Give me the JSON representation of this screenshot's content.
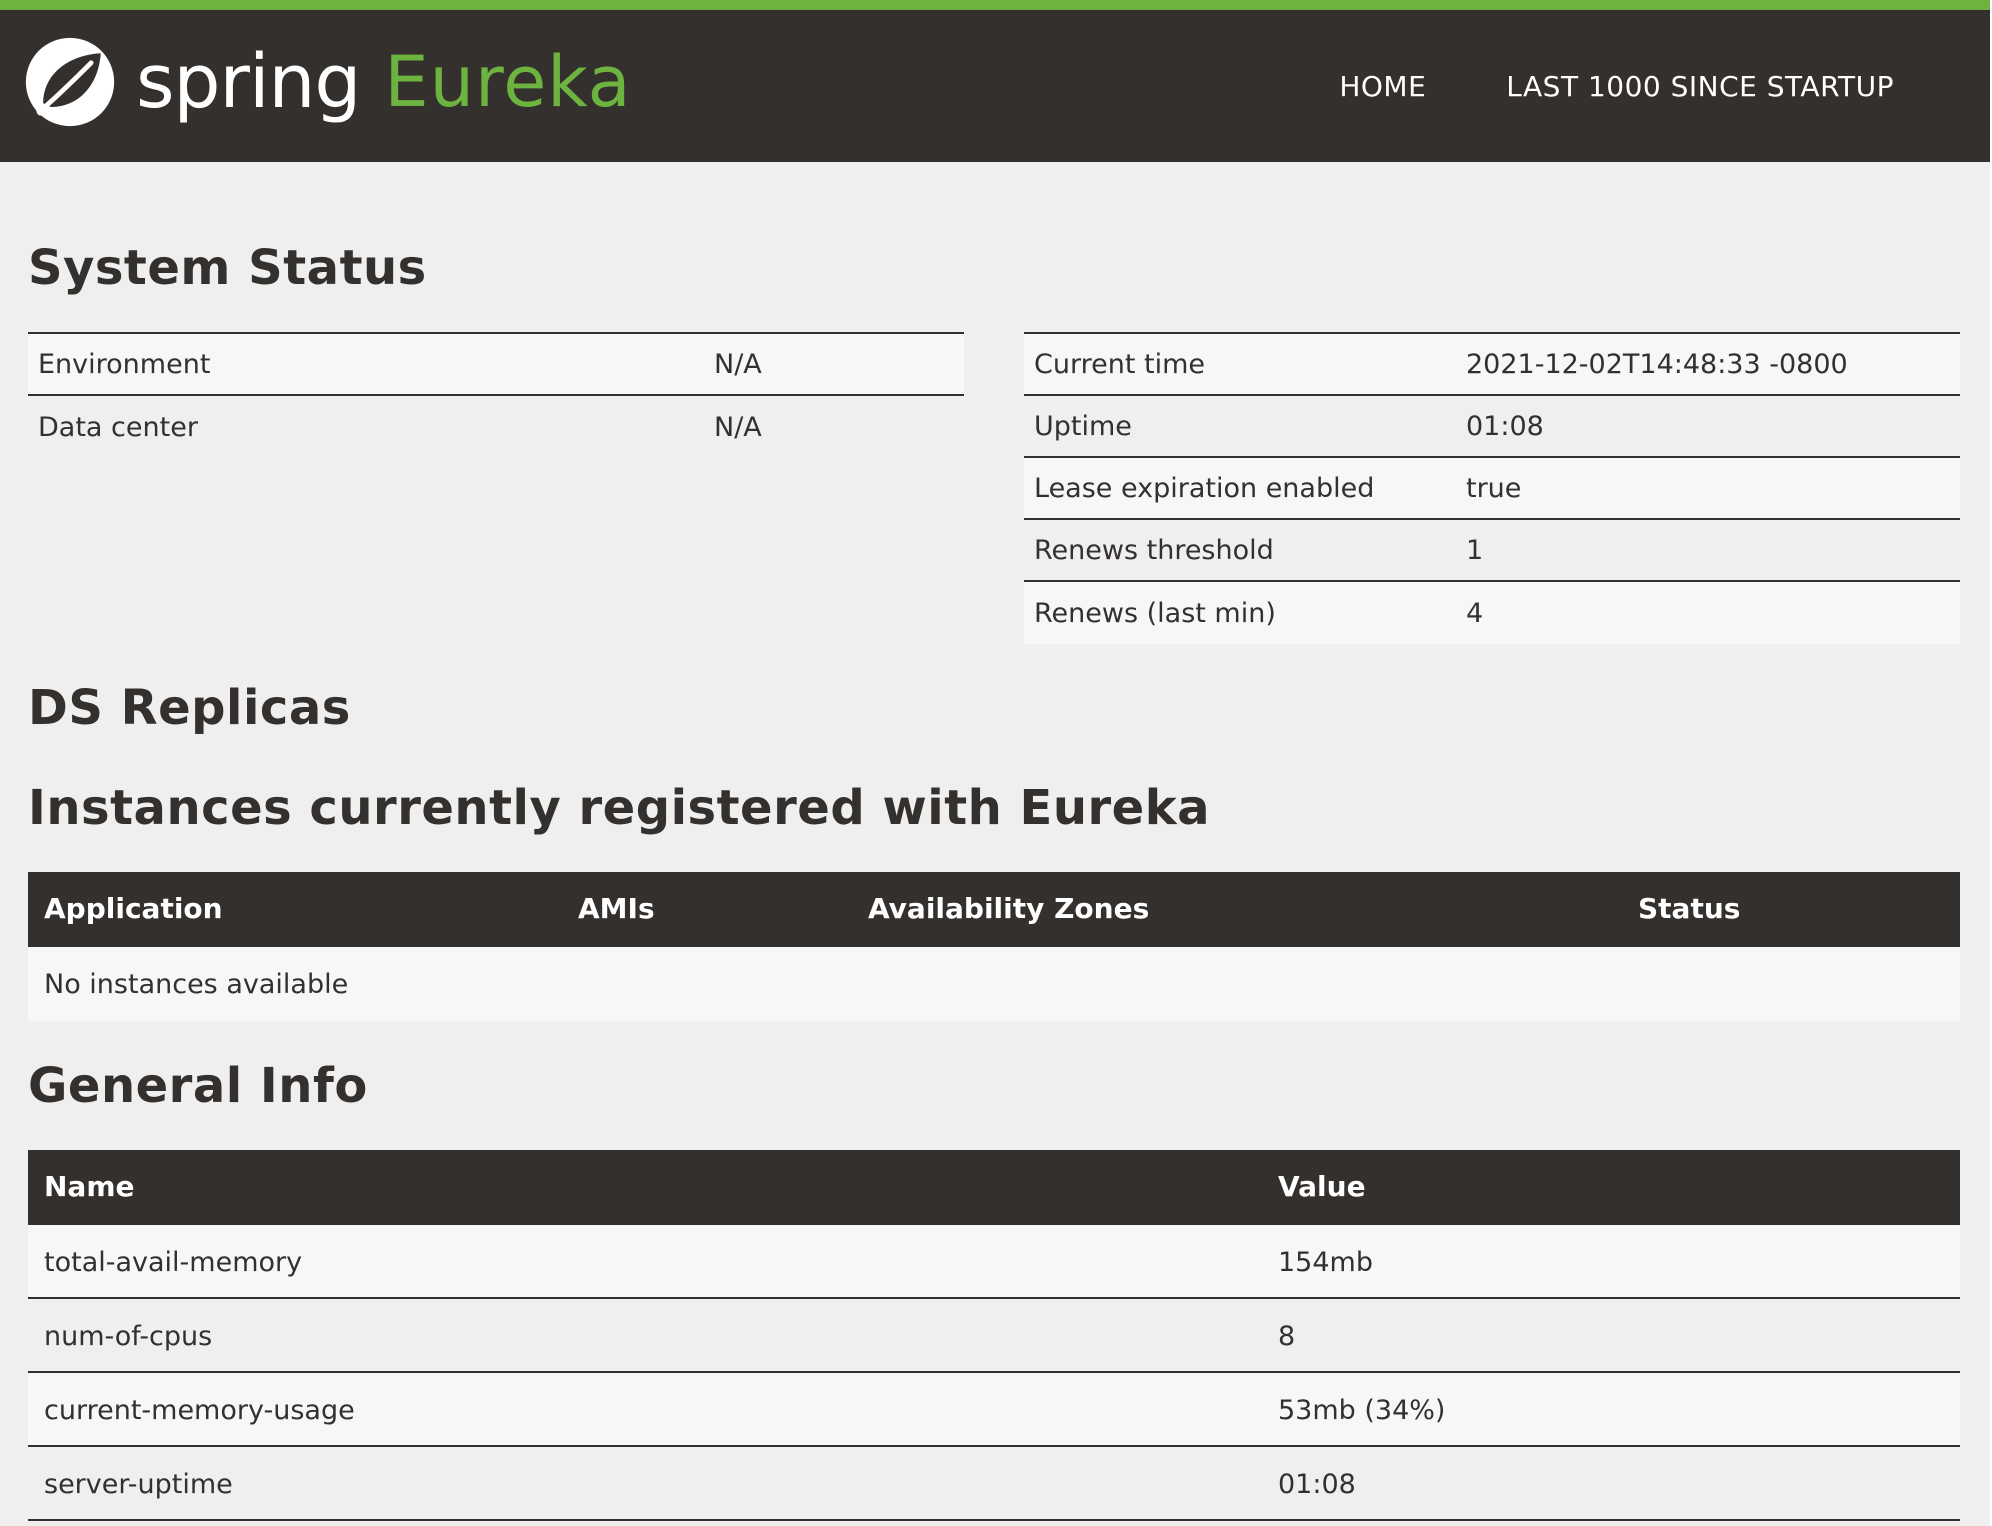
{
  "brand": {
    "spring": "spring",
    "eureka": "Eureka"
  },
  "nav": {
    "home": "HOME",
    "last1000": "LAST 1000 SINCE STARTUP"
  },
  "colors": {
    "navbar": "#34302d",
    "accent_green": "#6db33f",
    "background": "#efefef"
  },
  "system_status": {
    "title": "System Status",
    "left": [
      {
        "key": "Environment",
        "value": "N/A"
      },
      {
        "key": "Data center",
        "value": "N/A"
      }
    ],
    "right": [
      {
        "key": "Current time",
        "value": "2021-12-02T14:48:33 -0800"
      },
      {
        "key": "Uptime",
        "value": "01:08"
      },
      {
        "key": "Lease expiration enabled",
        "value": "true"
      },
      {
        "key": "Renews threshold",
        "value": "1"
      },
      {
        "key": "Renews (last min)",
        "value": "4"
      }
    ]
  },
  "ds_replicas": {
    "title": "DS Replicas"
  },
  "instances": {
    "title": "Instances currently registered with Eureka",
    "columns": [
      "Application",
      "AMIs",
      "Availability Zones",
      "Status"
    ],
    "empty_message": "No instances available"
  },
  "general_info": {
    "title": "General Info",
    "columns": [
      "Name",
      "Value"
    ],
    "rows": [
      {
        "name": "total-avail-memory",
        "value": "154mb"
      },
      {
        "name": "num-of-cpus",
        "value": "8"
      },
      {
        "name": "current-memory-usage",
        "value": "53mb (34%)"
      },
      {
        "name": "server-uptime",
        "value": "01:08"
      }
    ]
  }
}
